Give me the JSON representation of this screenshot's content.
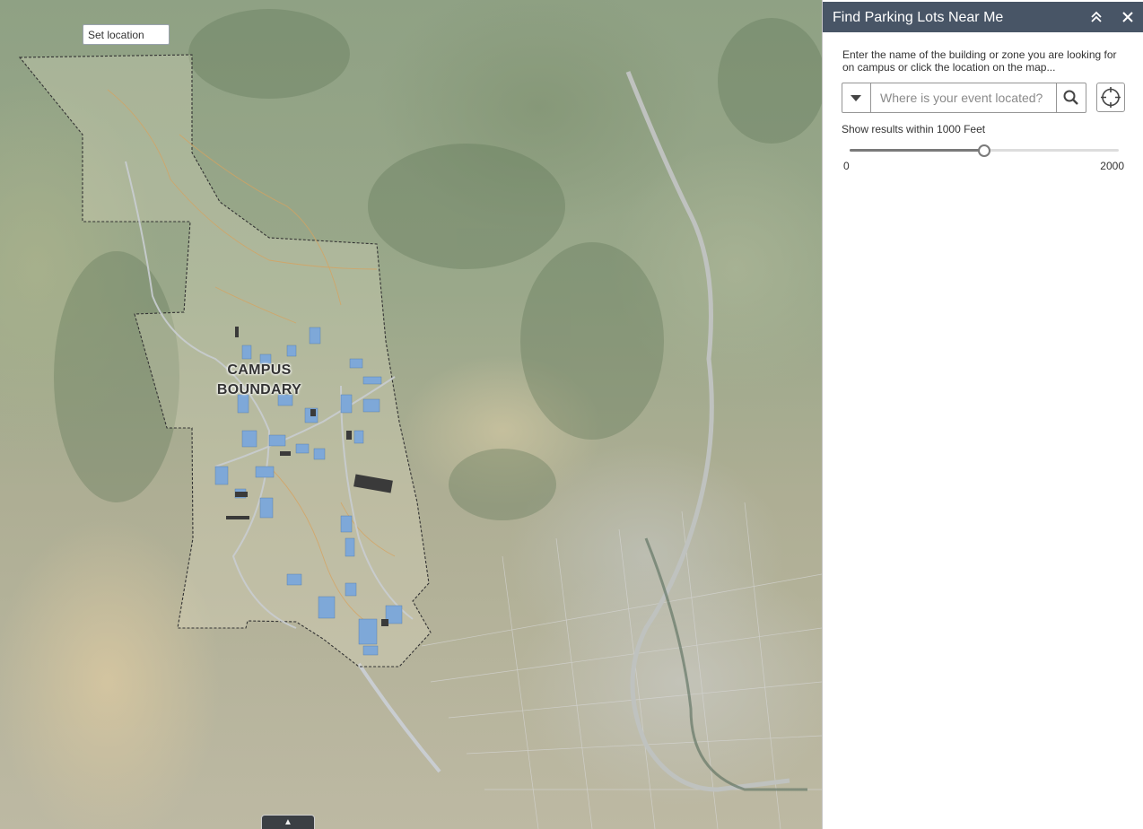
{
  "map": {
    "set_location_label": "Set location",
    "campus_label_line1": "CAMPUS",
    "campus_label_line2": "BOUNDARY",
    "bottom_tab_icon": "caret-up-icon"
  },
  "panel": {
    "title": "Find Parking Lots Near Me",
    "collapse_icon": "double-chevron-up-icon",
    "close_icon": "close-icon",
    "instructions": "Enter the name of the building or zone you are looking for on campus or click the location on the map...",
    "search": {
      "placeholder": "Where is your event located?",
      "value": "",
      "dropdown_icon": "caret-down-icon",
      "search_icon": "search-icon",
      "locate_icon": "crosshair-icon"
    },
    "radius": {
      "label": "Show results within 1000 Feet",
      "value": 1000,
      "min": 0,
      "max": 2000,
      "min_label": "0",
      "max_label": "2000"
    }
  },
  "colors": {
    "header_bg": "#485566",
    "building_blue": "#7ea8d8",
    "parking_dark": "#3a3a3a",
    "trail_orange": "#d6a360",
    "road_gray": "#c9cdd1"
  }
}
